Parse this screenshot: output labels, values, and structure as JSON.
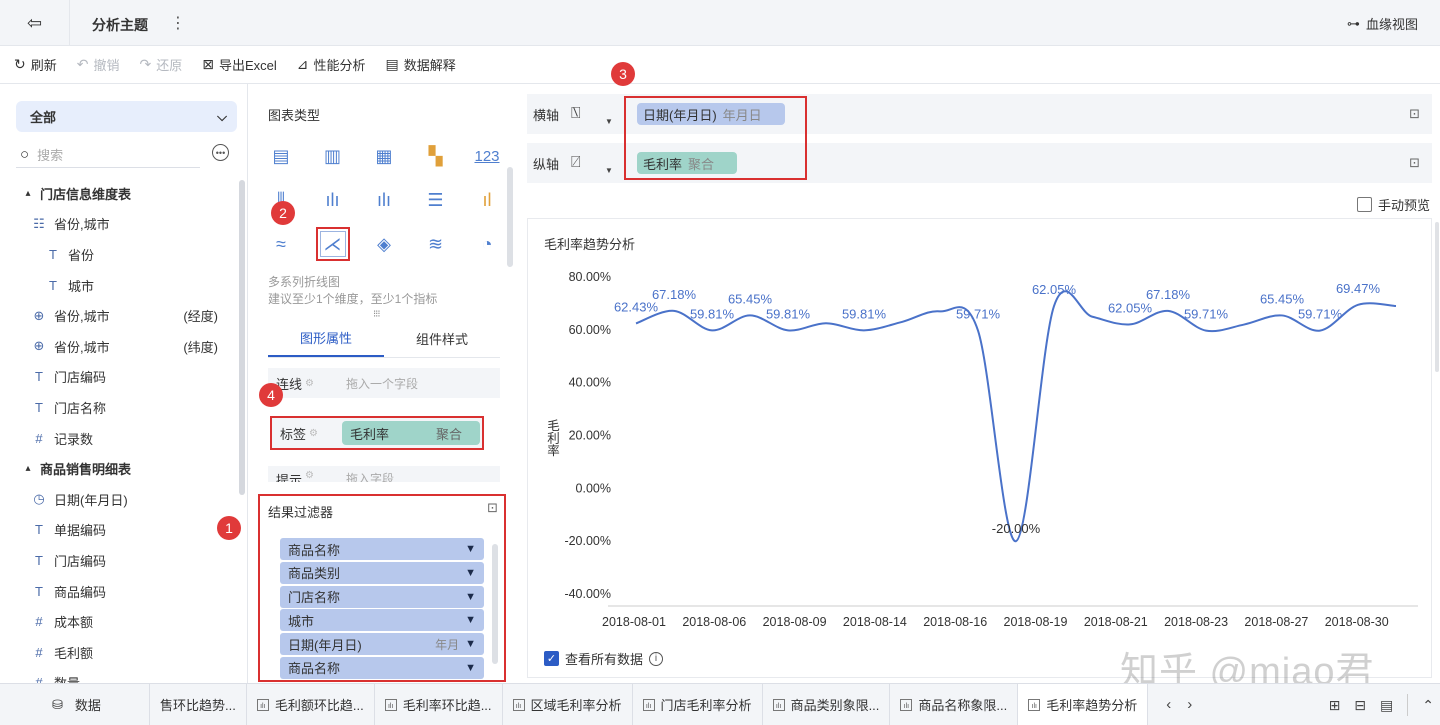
{
  "header": {
    "title": "分析主题",
    "lineage_label": "血缘视图"
  },
  "toolbar": {
    "refresh": "刷新",
    "undo": "撤销",
    "redo": "还原",
    "export": "导出Excel",
    "perf": "性能分析",
    "explain": "数据解释"
  },
  "left": {
    "scope": "全部",
    "search_placeholder": "搜索",
    "tree": [
      {
        "label": "门店信息维度表",
        "type": "group",
        "icon": "▴"
      },
      {
        "label": "省份,城市",
        "type": "field",
        "icon": "hierarchy-icon"
      },
      {
        "label": "省份",
        "type": "sub",
        "icon": "T"
      },
      {
        "label": "城市",
        "type": "sub",
        "icon": "T"
      },
      {
        "label": "省份,城市",
        "type": "field",
        "icon": "globe-icon",
        "suffix": "(经度)"
      },
      {
        "label": "省份,城市",
        "type": "field",
        "icon": "globe-icon",
        "suffix": "(纬度)"
      },
      {
        "label": "门店编码",
        "type": "field",
        "icon": "T"
      },
      {
        "label": "门店名称",
        "type": "field",
        "icon": "T"
      },
      {
        "label": "记录数",
        "type": "field",
        "icon": "#"
      },
      {
        "label": "商品销售明细表",
        "type": "group",
        "icon": "▴"
      },
      {
        "label": "日期(年月日)",
        "type": "field",
        "icon": "clock-icon"
      },
      {
        "label": "单据编码",
        "type": "field",
        "icon": "T"
      },
      {
        "label": "门店编码",
        "type": "field",
        "icon": "T"
      },
      {
        "label": "商品编码",
        "type": "field",
        "icon": "T"
      },
      {
        "label": "成本额",
        "type": "field",
        "icon": "#"
      },
      {
        "label": "毛利额",
        "type": "field",
        "icon": "#"
      },
      {
        "label": "数量",
        "type": "field",
        "icon": "#"
      }
    ]
  },
  "middle": {
    "chart_type_label": "图表类型",
    "chart_desc_1": "多系列折线图",
    "chart_desc_2": "建议至少1个维度，至少1个指标",
    "tab_shape": "图形属性",
    "tab_style": "组件样式",
    "line_label": "连线",
    "line_placeholder": "拖入一个字段",
    "tag_label": "标签",
    "tag_field": "毛利率",
    "tag_agg": "聚合",
    "tip_label": "提示",
    "tip_placeholder": "拖入字段",
    "filter_title": "结果过滤器",
    "filters": [
      {
        "label": "商品名称",
        "sub": ""
      },
      {
        "label": "商品类别",
        "sub": ""
      },
      {
        "label": "门店名称",
        "sub": ""
      },
      {
        "label": "城市",
        "sub": ""
      },
      {
        "label": "日期(年月日)",
        "sub": "年月"
      },
      {
        "label": "商品名称",
        "sub": ""
      }
    ]
  },
  "markers": {
    "m1": "1",
    "m2": "2",
    "m3": "3",
    "m4": "4"
  },
  "axes": {
    "x_label": "横轴",
    "x_field": "日期(年月日)",
    "x_sub": "年月日",
    "y_label": "纵轴",
    "y_field": "毛利率",
    "y_sub": "聚合"
  },
  "manual_preview": "手动预览",
  "view_all": "查看所有数据",
  "watermark": "知乎 @miao君",
  "chart_data": {
    "type": "line",
    "title": "毛利率趋势分析",
    "ylabel": "毛利率",
    "ylim": [
      -40,
      80
    ],
    "yticks": [
      "80.00%",
      "60.00%",
      "40.00%",
      "20.00%",
      "0.00%",
      "-20.00%",
      "-40.00%"
    ],
    "xticks": [
      "2018-08-01",
      "2018-08-06",
      "2018-08-09",
      "2018-08-14",
      "2018-08-16",
      "2018-08-19",
      "2018-08-21",
      "2018-08-23",
      "2018-08-27",
      "2018-08-30"
    ],
    "series": [
      {
        "values": [
          62.43,
          67.18,
          59.81,
          65.45,
          59.81,
          62.5,
          59.81,
          63.0,
          67.0,
          59.71,
          -20.0,
          69.0,
          65.0,
          62.05,
          67.18,
          59.71,
          62.0,
          65.45,
          59.71,
          69.47,
          69.0
        ],
        "labels": [
          "62.43%",
          "67.18%",
          "59.81%",
          "65.45%",
          "59.81%",
          "",
          "59.81%",
          "",
          "",
          "59.71%",
          "-20.00%",
          "62.05%",
          "",
          "62.05%",
          "67.18%",
          "59.71%",
          "",
          "65.45%",
          "59.71%",
          "69.47%",
          ""
        ]
      }
    ],
    "color": "#4a72c9",
    "grid": false
  },
  "bottom": {
    "data_label": "数据",
    "tabs": [
      "售环比趋势...",
      "毛利额环比趋...",
      "毛利率环比趋...",
      "区域毛利率分析",
      "门店毛利率分析",
      "商品类别象限...",
      "商品名称象限...",
      "毛利率趋势分析"
    ]
  }
}
